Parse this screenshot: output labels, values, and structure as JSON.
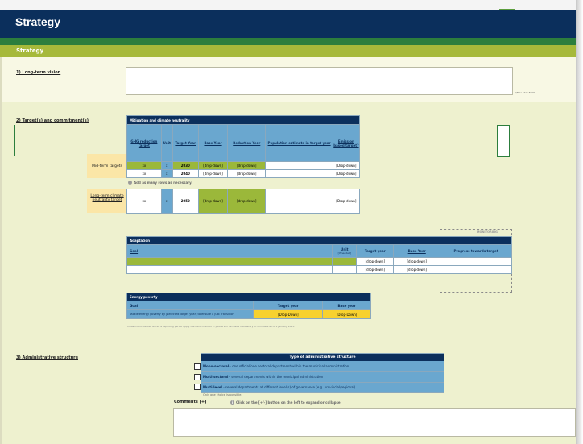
{
  "title": "Strategy",
  "section_bar": "Strategy",
  "sections": {
    "s1": "1)  Long-term vision",
    "s2": "2)  Target(s) and commitment(s)",
    "s3": "3)  Administrative structure"
  },
  "vision_counter": "0/Max.char 5000",
  "mitigation": {
    "title": "Mitigation and climate neutrality",
    "headers": [
      "GHG reduction target",
      "Unit",
      "Target Year",
      "Base Year",
      "Reduction Year",
      "Population estimate in target year",
      "Emission based target?"
    ],
    "mid_label": "Mid-term targets",
    "long_label": "Long-term climate neutrality target",
    "rows": [
      {
        "value": "xx",
        "unit": "x",
        "year": "2030",
        "base": "[drop-down]",
        "red": "[drop-down]",
        "pop": "",
        "emission": "[Drop-down]"
      },
      {
        "value": "xx",
        "unit": "x",
        "year": "2040",
        "base": "[drop-down]",
        "red": "[drop-down]",
        "pop": "",
        "emission": "[Drop-down]"
      }
    ],
    "add_hint": "Add as many rows as necessary.",
    "long_row": {
      "value": "xx",
      "unit": "x",
      "year": "2050",
      "base": "[drop-down]",
      "red": "[drop-down]",
      "pop": "",
      "emission": "[Drop-down]"
    }
  },
  "adaptation": {
    "title": "Adaptation",
    "headers": [
      "Goal",
      "Unit",
      "Target year",
      "Base Year",
      "Progress towards target"
    ],
    "unit_sub": "[if needed]",
    "monitoring_label": "MONITORING",
    "rows": [
      {
        "goal": "",
        "unit": "",
        "target": "[drop-down]",
        "base": "[drop-down]",
        "progress": ""
      },
      {
        "goal": "",
        "unit": "",
        "target": "[drop-down]",
        "base": "[drop-down]",
        "progress": ""
      }
    ]
  },
  "energy": {
    "title": "Energy poverty",
    "headers": [
      "Goal",
      "Target year",
      "Base year"
    ],
    "goal": "Tackle energy poverty by [selected target year] to ensure a just transition",
    "target": "[Drop-Down]",
    "base": "[Drop-Down]",
    "note": "Cities/municipalities within a reporting period apply the fields marked in yellow will be made mandatory to complete as of 1 January 2025."
  },
  "admin": {
    "title": "Type of administrative structure",
    "options": [
      {
        "bold": "Mono-sectoral",
        "text": " - one official/one sectoral department within the municipal administration"
      },
      {
        "bold": "Multi-sectoral",
        "text": " - several departments within the municipal administration"
      },
      {
        "bold": "Multi-level",
        "text": " - several departments at different level(s) of governance (e.g. provincial/regional)"
      }
    ],
    "only_one": "Only one choice is possible.",
    "comments_label": "Comments [+]",
    "comments_hint": "Click on the [+/-] button on the left to expand or collapse."
  },
  "colors": {
    "navy": "#0b2f5c",
    "olive": "#9bb83a",
    "blue": "#6aa7cf",
    "yellow": "#f7d12f"
  }
}
